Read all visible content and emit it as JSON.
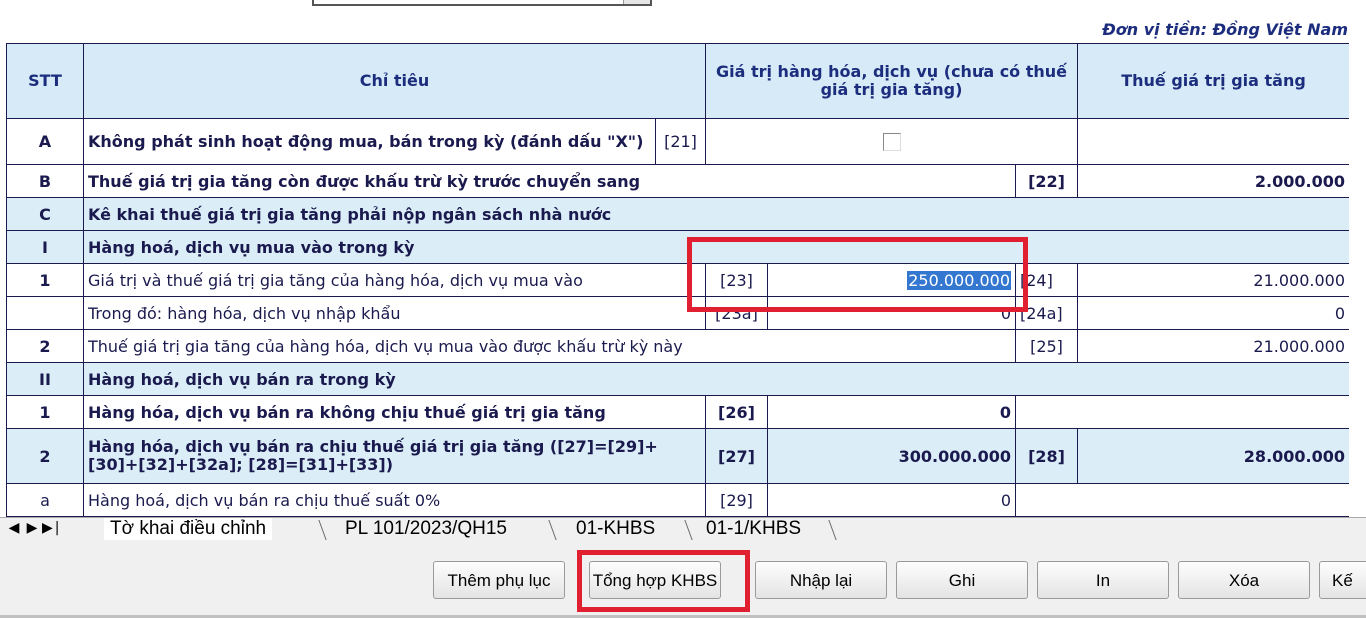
{
  "unit_label": "Đơn vị tiền: Đồng Việt Nam",
  "headers": {
    "stt": "STT",
    "chi_tieu": "Chỉ tiêu",
    "gia_tri": "Giá trị hàng hóa, dịch vụ (chưa có thuế giá trị gia tăng)",
    "thue": "Thuế giá trị gia tăng"
  },
  "rows": {
    "A": {
      "stt": "A",
      "label": "Không phát sinh hoạt động mua, bán trong kỳ (đánh dấu \"X\")",
      "code": "[21]"
    },
    "B": {
      "stt": "B",
      "label": "Thuế giá trị gia tăng còn được khấu trừ kỳ trước chuyển sang",
      "code": "[22]",
      "value": "2.000.000"
    },
    "C": {
      "stt": "C",
      "label": "Kê khai thuế giá trị gia tăng phải nộp ngân sách nhà nước"
    },
    "I": {
      "stt": "I",
      "label": "Hàng hoá, dịch vụ mua vào trong kỳ"
    },
    "I1": {
      "stt": "1",
      "label": "Giá trị và thuế giá trị gia tăng của hàng hóa, dịch vụ mua vào",
      "code1": "[23]",
      "value1": "250.000.000",
      "code2": "[24]",
      "value2": "21.000.000"
    },
    "I1a": {
      "label": "Trong đó: hàng hóa, dịch vụ nhập khẩu",
      "code1": "[23a]",
      "value1": "0",
      "code2": "[24a]",
      "value2": "0"
    },
    "I2": {
      "stt": "2",
      "label": "Thuế giá trị gia tăng của hàng hóa, dịch vụ mua vào được khấu trừ kỳ này",
      "code": "[25]",
      "value": "21.000.000"
    },
    "II": {
      "stt": "II",
      "label": "Hàng hoá, dịch vụ bán ra trong kỳ"
    },
    "II1": {
      "stt": "1",
      "label": "Hàng hóa, dịch vụ bán ra không chịu thuế giá trị gia tăng",
      "code": "[26]",
      "value": "0"
    },
    "II2": {
      "stt": "2",
      "label": "Hàng hóa, dịch vụ bán ra chịu thuế giá trị gia tăng ([27]=[29]+[30]+[32]+[32a]; [28]=[31]+[33])",
      "code1": "[27]",
      "value1": "300.000.000",
      "code2": "[28]",
      "value2": "28.000.000"
    },
    "IIa": {
      "stt": "a",
      "label": "Hàng hoá, dịch vụ bán ra chịu thuế suất 0%",
      "code": "[29]",
      "value": "0"
    }
  },
  "tabs": [
    "Tờ khai điều chỉnh",
    "PL 101/2023/QH15",
    "01-KHBS",
    "01-1/KHBS"
  ],
  "buttons": {
    "them_phu_luc": "Thêm phụ lục",
    "tong_hop": "Tổng hợp KHBS",
    "nhap_lai": "Nhập lại",
    "ghi": "Ghi",
    "in": "In",
    "xoa": "Xóa",
    "ket_thuc": "Kế"
  },
  "colors": {
    "header_bg": "#d6eaf7",
    "section_bg": "#dbeef8",
    "highlight": "#e02030",
    "text": "#1c2d7e"
  }
}
